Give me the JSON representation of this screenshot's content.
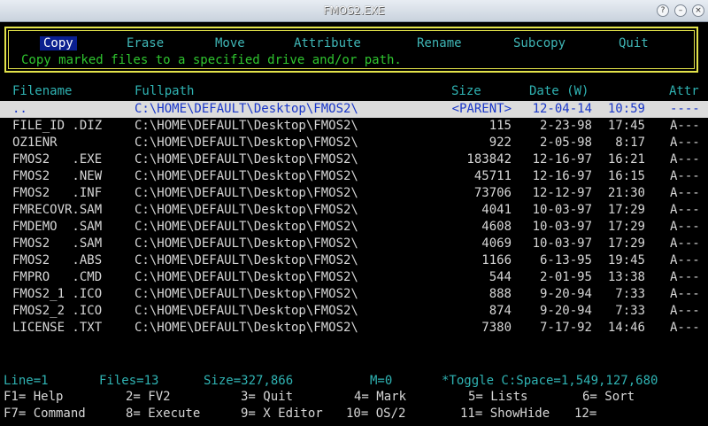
{
  "window": {
    "title": "FMOS2.EXE"
  },
  "menu": {
    "items": [
      "Copy",
      "Erase",
      "Move",
      "Attribute",
      "Rename",
      "Subcopy",
      "Quit"
    ],
    "hint": "Copy marked files to a specified drive and/or path."
  },
  "columns": {
    "filename": "Filename",
    "fullpath": "Fullpath",
    "size": "Size",
    "date": "Date (W)",
    "attr": "Attr"
  },
  "files": [
    {
      "name": "..",
      "path": "C:\\HOME\\DEFAULT\\Desktop\\FMOS2\\",
      "size": "<PARENT>",
      "date": "12-04-14",
      "time": "10:59",
      "attr": "----"
    },
    {
      "name": "FILE_ID .DIZ",
      "path": "C:\\HOME\\DEFAULT\\Desktop\\FMOS2\\",
      "size": "115",
      "date": "2-23-98",
      "time": "17:45",
      "attr": "A---"
    },
    {
      "name": "OZ1ENR",
      "path": "C:\\HOME\\DEFAULT\\Desktop\\FMOS2\\",
      "size": "922",
      "date": "2-05-98",
      "time": "8:17",
      "attr": "A---"
    },
    {
      "name": "FMOS2   .EXE",
      "path": "C:\\HOME\\DEFAULT\\Desktop\\FMOS2\\",
      "size": "183842",
      "date": "12-16-97",
      "time": "16:21",
      "attr": "A---"
    },
    {
      "name": "FMOS2   .NEW",
      "path": "C:\\HOME\\DEFAULT\\Desktop\\FMOS2\\",
      "size": "45711",
      "date": "12-16-97",
      "time": "16:15",
      "attr": "A---"
    },
    {
      "name": "FMOS2   .INF",
      "path": "C:\\HOME\\DEFAULT\\Desktop\\FMOS2\\",
      "size": "73706",
      "date": "12-12-97",
      "time": "21:30",
      "attr": "A---"
    },
    {
      "name": "FMRECOVR.SAM",
      "path": "C:\\HOME\\DEFAULT\\Desktop\\FMOS2\\",
      "size": "4041",
      "date": "10-03-97",
      "time": "17:29",
      "attr": "A---"
    },
    {
      "name": "FMDEMO  .SAM",
      "path": "C:\\HOME\\DEFAULT\\Desktop\\FMOS2\\",
      "size": "4608",
      "date": "10-03-97",
      "time": "17:29",
      "attr": "A---"
    },
    {
      "name": "FMOS2   .SAM",
      "path": "C:\\HOME\\DEFAULT\\Desktop\\FMOS2\\",
      "size": "4069",
      "date": "10-03-97",
      "time": "17:29",
      "attr": "A---"
    },
    {
      "name": "FMOS2   .ABS",
      "path": "C:\\HOME\\DEFAULT\\Desktop\\FMOS2\\",
      "size": "1166",
      "date": "6-13-95",
      "time": "19:45",
      "attr": "A---"
    },
    {
      "name": "FMPRO   .CMD",
      "path": "C:\\HOME\\DEFAULT\\Desktop\\FMOS2\\",
      "size": "544",
      "date": "2-01-95",
      "time": "13:38",
      "attr": "A---"
    },
    {
      "name": "FMOS2_1 .ICO",
      "path": "C:\\HOME\\DEFAULT\\Desktop\\FMOS2\\",
      "size": "888",
      "date": "9-20-94",
      "time": "7:33",
      "attr": "A---"
    },
    {
      "name": "FMOS2_2 .ICO",
      "path": "C:\\HOME\\DEFAULT\\Desktop\\FMOS2\\",
      "size": "874",
      "date": "9-20-94",
      "time": "7:33",
      "attr": "A---"
    },
    {
      "name": "LICENSE .TXT",
      "path": "C:\\HOME\\DEFAULT\\Desktop\\FMOS2\\",
      "size": "7380",
      "date": "7-17-92",
      "time": "14:46",
      "attr": "A---"
    }
  ],
  "status": {
    "line": "Line=1",
    "files": "Files=13",
    "size": "Size=327,866",
    "mark": "M=0",
    "space": "*Toggle C:Space=1,549,127,680"
  },
  "fkeys": {
    "row1": [
      "F1= Help",
      "2= FV2",
      "3= Quit",
      "4= Mark",
      "5= Lists",
      "6= Sort"
    ],
    "row2": [
      "F7= Command",
      "8= Execute",
      "9= X Editor",
      "10= OS/2",
      "11= ShowHide",
      "12="
    ]
  },
  "colors": {
    "menu_box": "#e3e34a",
    "menu_text": "#3fb6b6",
    "hint": "#2fc52f",
    "selected_row": "#dcdcdc"
  }
}
